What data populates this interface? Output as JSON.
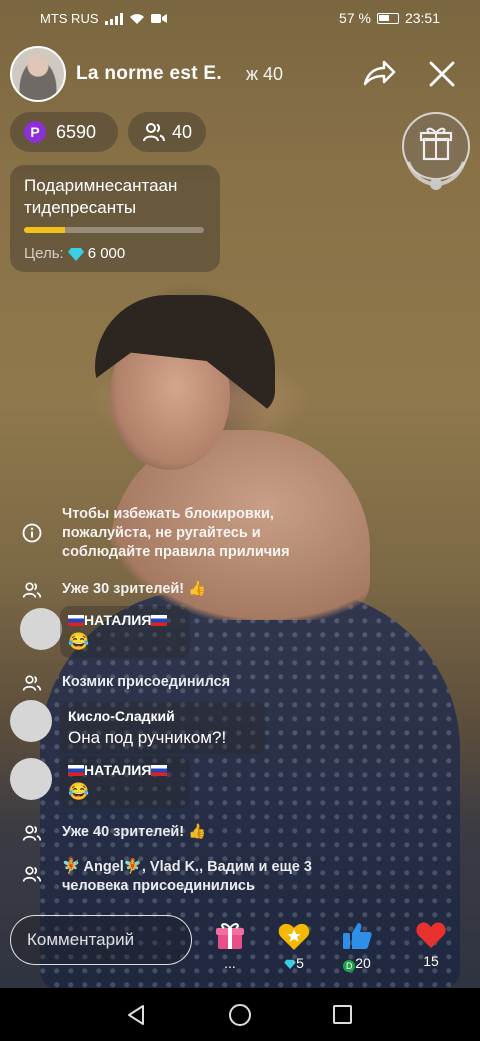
{
  "status_bar": {
    "carrier": "MTS RUS",
    "battery": "57 %",
    "time": "23:51"
  },
  "header": {
    "name": "La norme est E.",
    "views": "ж 40"
  },
  "stats": {
    "coins": "6590",
    "coin_symbol": "P",
    "viewers": "40"
  },
  "goal": {
    "title": "Подаримнесантаан тидепресанты",
    "label": "Цель:",
    "amount": "6 000",
    "progress": 0.23
  },
  "chat": [
    {
      "type": "system",
      "icon": "info-icon",
      "text": "Чтобы избежать блокировки, пожалуйста, не ругайтесь и соблюдайте правила приличия"
    },
    {
      "type": "event",
      "icon": "users-icon",
      "text": "Уже 30 зрителей! 👍"
    },
    {
      "type": "message",
      "name": "НАТАЛИЯ",
      "flags": true,
      "text": "😂"
    },
    {
      "type": "event",
      "icon": "users-icon",
      "text": "Козмик присоединился"
    },
    {
      "type": "message",
      "name": "Кисло-Сладкий",
      "flags": false,
      "text": "Она под ручником?!"
    },
    {
      "type": "message",
      "name": "НАТАЛИЯ",
      "flags": true,
      "text": "😂"
    },
    {
      "type": "event",
      "icon": "users-icon",
      "text": "Уже 40 зрителей! 👍"
    },
    {
      "type": "event",
      "icon": "users-icon",
      "text": "🧚 Angel🧚, Vlad K., Вадим и еще 3 человека присоединились"
    }
  ],
  "bottom": {
    "comment_placeholder": "Комментарий",
    "gift_more": "...",
    "star_count": "5",
    "like_count": "20",
    "heart_count": "15"
  },
  "colors": {
    "accent_coin": "#8b2fd6",
    "progress": "#f1c21b",
    "heart": "#e8322f",
    "like": "#2f8ee8",
    "gift": "#e94e8a",
    "star": "#f5b800"
  }
}
